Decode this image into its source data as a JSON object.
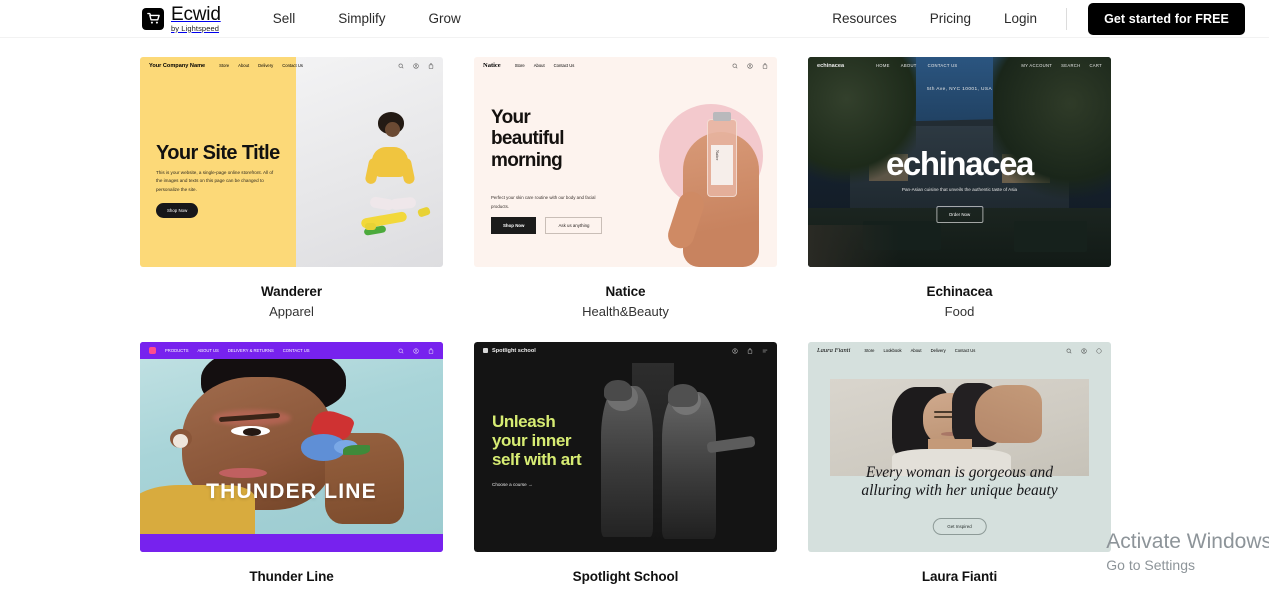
{
  "header": {
    "brand": {
      "name": "Ecwid",
      "tagline": "by Lightspeed",
      "icon": "shopping-cart-icon"
    },
    "nav_left": [
      {
        "label": "Sell"
      },
      {
        "label": "Simplify"
      },
      {
        "label": "Grow"
      }
    ],
    "nav_right": [
      {
        "label": "Resources"
      },
      {
        "label": "Pricing"
      },
      {
        "label": "Login"
      }
    ],
    "cta_label": "Get started for FREE"
  },
  "templates": [
    {
      "title": "Wanderer",
      "category": "Apparel",
      "preview": {
        "logo": "Your Company Name",
        "links": [
          "Store",
          "About",
          "Delivery",
          "Contact Us"
        ],
        "icons": [
          "search-icon",
          "account-icon",
          "bag-icon"
        ],
        "heading": "Your Site Title",
        "body": "This is your website, a single-page online storefront. All of the images and texts on this page can be changed to personalize the site.",
        "button": "Shop Now"
      }
    },
    {
      "title": "Natice",
      "category": "Health&Beauty",
      "preview": {
        "logo": "Natice",
        "links": [
          "Store",
          "About",
          "Contact Us"
        ],
        "icons": [
          "search-icon",
          "account-icon",
          "bag-icon"
        ],
        "heading_line1": "Your",
        "heading_line2": "beautiful",
        "heading_line3": "morning",
        "body": "Perfect your skin care routine with our body and facial products.",
        "button_primary": "Shop Now",
        "button_secondary": "Ask us anything",
        "bottle_label": "Natice"
      }
    },
    {
      "title": "Echinacea",
      "category": "Food",
      "preview": {
        "logo": "echinacea",
        "links": [
          "HOME",
          "ABOUT",
          "CONTACT US"
        ],
        "right_links": [
          "MY ACCOUNT",
          "SEARCH",
          "CART"
        ],
        "address": "5th Ave, NYC 10001, USA",
        "wordmark": "echinacea",
        "tagline": "Pan-Asian cuisine that unveils the authentic taste of Asia",
        "button": "Order Now"
      }
    },
    {
      "title": "Thunder Line",
      "category": "",
      "preview": {
        "links": [
          "PRODUCTS",
          "ABOUT US",
          "DELIVERY & RETURNS",
          "CONTACT US"
        ],
        "icons": [
          "search-icon",
          "account-icon",
          "bag-icon"
        ],
        "wordmark": "THUNDER LINE",
        "accent_color": "#7722ee"
      }
    },
    {
      "title": "Spotlight School",
      "category": "",
      "preview": {
        "logo": "Spotlight school",
        "icons": [
          "account-icon",
          "bag-icon",
          "menu-icon"
        ],
        "heading_line1": "Unleash",
        "heading_line2": "your inner",
        "heading_line3": "self with art",
        "link": "Choose a course →",
        "accent_color": "#d7ec73"
      }
    },
    {
      "title": "Laura Fianti",
      "category": "",
      "preview": {
        "logo": "Laura Fianti",
        "links": [
          "Store",
          "Lookbook",
          "About",
          "Delivery",
          "Contact Us"
        ],
        "icons": [
          "search-icon",
          "account-icon",
          "bag-icon"
        ],
        "quote_line1": "Every woman is gorgeous and",
        "quote_line2": "alluring with her unique beauty",
        "button": "Get Inspired"
      }
    }
  ],
  "watermark": {
    "title": "Activate Windows",
    "subtitle": "Go to Settings"
  }
}
